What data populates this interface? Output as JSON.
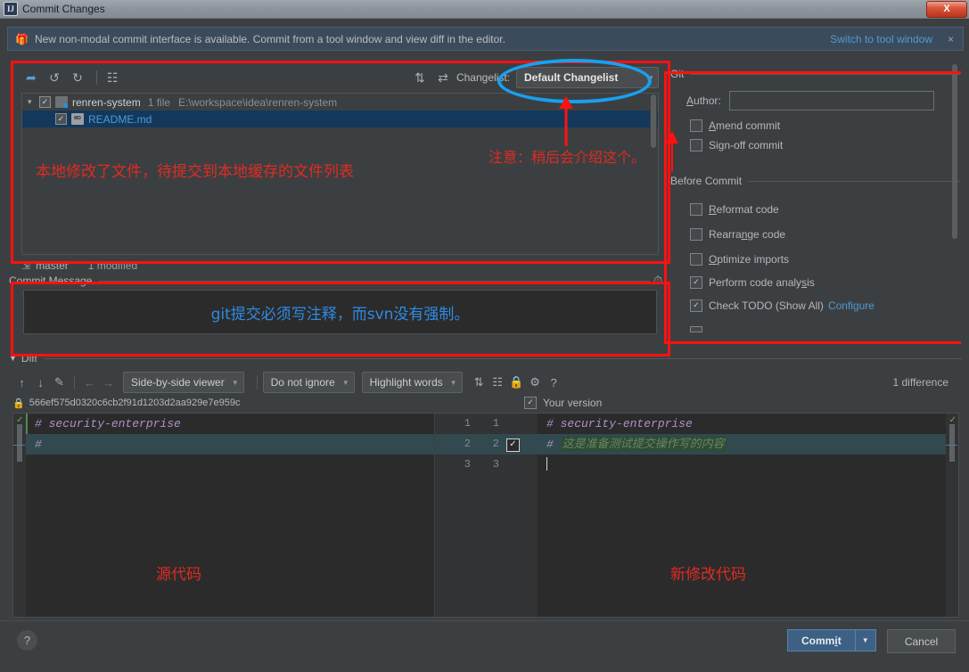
{
  "window": {
    "title": "Commit Changes",
    "icon": "intellij-idea-icon",
    "close_label": "X"
  },
  "notification": {
    "icon": "gift-icon",
    "text": "New non-modal commit interface is available. Commit from a tool window and view diff in the editor.",
    "link": "Switch to tool window",
    "close": "×"
  },
  "changes": {
    "toolbar": {
      "collapse_icon": "show-diff-icon",
      "revert_icon": "revert-icon",
      "refresh_icon": "refresh-icon",
      "group_icon": "group-by-icon",
      "expand_all_icon": "expand-all-icon",
      "collapse_all_icon": "collapse-all-icon"
    },
    "changelist_label": "Changelist:",
    "changelist_value": "Default Changelist",
    "tree": [
      {
        "type": "folder",
        "name": "renren-system",
        "file_count": "1 file",
        "path": "E:\\workspace\\idea\\renren-system",
        "checked": true,
        "expanded": true
      },
      {
        "type": "file",
        "name": "README.md",
        "checked": true,
        "selected": true,
        "icon": "markdown-file-icon"
      }
    ],
    "status": {
      "branch_icon": "branch-icon",
      "branch": "master",
      "modified": "1 modified"
    }
  },
  "commit_message": {
    "title": "Commit Message",
    "title_mnemonic": "C",
    "history_icon": "clock-history-icon",
    "value": "",
    "annotation": "git提交必须写注释，而svn没有强制。"
  },
  "options": {
    "git_group": "Git",
    "author_label": "Author:",
    "author_value": "",
    "git_checkboxes": [
      {
        "label": "Amend commit",
        "checked": false,
        "mnemonic": "A"
      },
      {
        "label": "Sign-off commit",
        "checked": false,
        "mnemonic": "g"
      }
    ],
    "before_commit_group": "Before Commit",
    "before_checkboxes": [
      {
        "label": "Reformat code",
        "checked": false,
        "mnemonic": "R"
      },
      {
        "label": "Rearrange code",
        "checked": false,
        "mnemonic": "n"
      },
      {
        "label": "Optimize imports",
        "checked": false,
        "mnemonic": "O"
      },
      {
        "label": "Perform code analysis",
        "checked": true,
        "mnemonic": "s"
      },
      {
        "label": "Check TODO (Show All)",
        "checked": true,
        "link": "Configure"
      }
    ]
  },
  "diff": {
    "section_title": "Diff",
    "toolbar": {
      "prev_diff_icon": "arrow-up-icon",
      "next_diff_icon": "arrow-down-icon",
      "edit_icon": "pencil-icon",
      "accept_left_icon": "arrow-left-icon",
      "accept_right_icon": "arrow-right-icon",
      "viewer_mode": "Side-by-side viewer",
      "ignore_mode": "Do not ignore",
      "highlight_mode": "Highlight words",
      "collapse_icon": "collapse-unchanged-icon",
      "whitespace_icon": "show-whitespace-icon",
      "lock_icon": "read-only-lock-icon",
      "settings_icon": "gear-icon",
      "help_icon": "question-icon"
    },
    "difference_count": "1 difference",
    "left_revision": {
      "lock_icon": "lock-icon",
      "hash": "566ef575d0320c6cb2f91d1203d2aa929e7e959c"
    },
    "right_revision": {
      "checked": true,
      "label": "Your version"
    },
    "left_lines": [
      {
        "num": "1",
        "text": "# security-enterprise",
        "state": "same"
      },
      {
        "num": "2",
        "text": "#",
        "state": "changed"
      },
      {
        "num": "3",
        "text": "",
        "state": "same"
      }
    ],
    "right_lines": [
      {
        "num": "1",
        "text": "# security-enterprise",
        "state": "same"
      },
      {
        "num": "2",
        "prefix": "# ",
        "inserted": "这是准备测试提交操作写的内容",
        "state": "changed"
      },
      {
        "num": "3",
        "text": "",
        "state": "caret"
      }
    ],
    "line_numbers": [
      {
        "left": "1",
        "right": "1",
        "checkbox": false
      },
      {
        "left": "2",
        "right": "2",
        "checkbox": true
      },
      {
        "left": "3",
        "right": "3",
        "checkbox": false
      }
    ],
    "annotation_left": "源代码",
    "annotation_right": "新修改代码"
  },
  "annotations": {
    "file_list_note": "本地修改了文件，待提交到本地缓存的文件列表",
    "changelist_note": "注意：稍后会介绍这个。",
    "highlight_color": "#ff1111",
    "circle_color": "#18a0f0",
    "blue_note_color": "#2e8be6"
  },
  "footer": {
    "help_label": "?",
    "commit_label": "Commit",
    "commit_mnemonic": "i",
    "commit_arrow": "▼",
    "cancel_label": "Cancel"
  }
}
